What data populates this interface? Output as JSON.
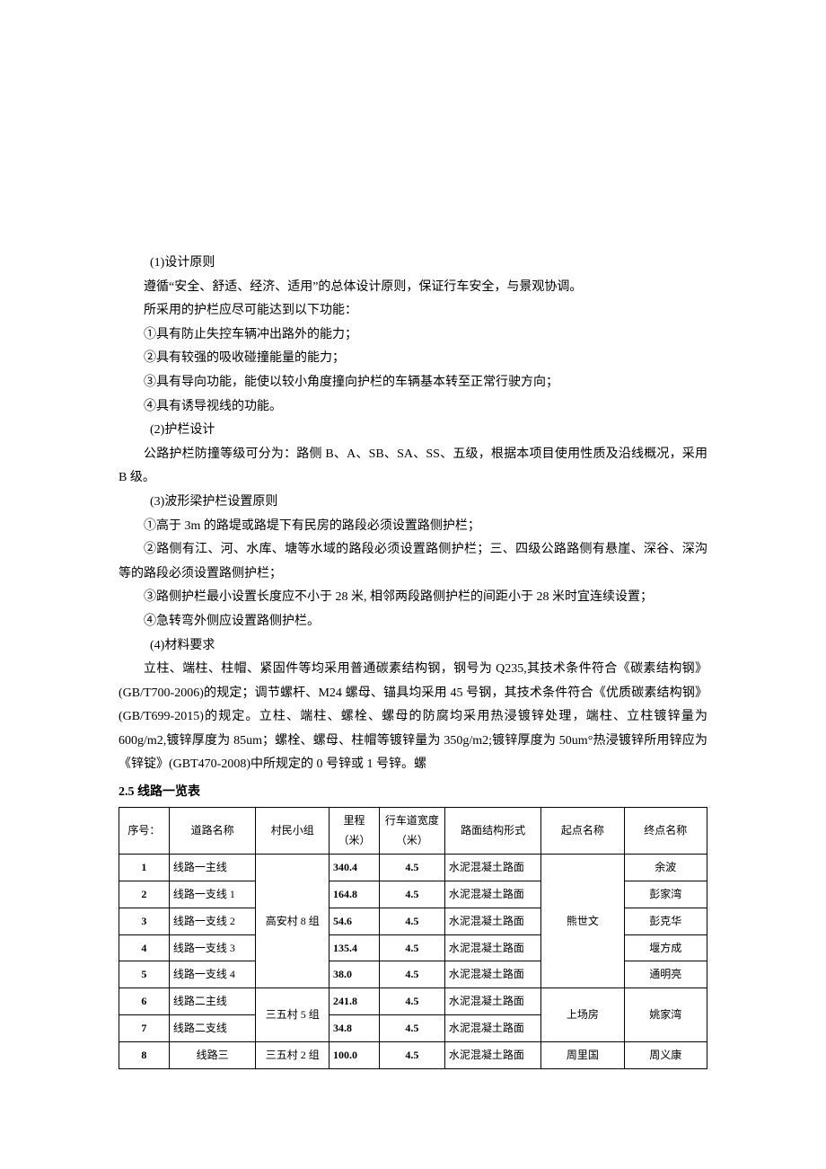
{
  "paragraphs": {
    "p1": "(1)设计原则",
    "p2": "遵循“安全、舒适、经济、适用”的总体设计原则，保证行车安全，与景观协调。",
    "p3": "所采用的护栏应尽可能达到以下功能：",
    "p4": "①具有防止失控车辆冲出路外的能力；",
    "p5": "②具有较强的吸收碰撞能量的能力；",
    "p6": "③具有导向功能，能使以较小角度撞向护栏的车辆基本转至正常行驶方向；",
    "p7": "④具有诱导视线的功能。",
    "p8": "(2)护栏设计",
    "p9": "公路护栏防撞等级可分为：路侧 B、A、SB、SA、SS、五级，根据本项目使用性质及沿线概况，采用 B 级。",
    "p10": "(3)波形梁护栏设置原则",
    "p11": "①高于 3m 的路堤或路堤下有民房的路段必须设置路侧护栏；",
    "p12": "②路侧有江、河、水库、塘等水域的路段必须设置路侧护栏；三、四级公路路侧有悬崖、深谷、深沟等的路段必须设置路侧护栏；",
    "p13": "③路侧护栏最小设置长度应不小于 28 米, 相邻两段路侧护栏的间距小于 28 米时宜连续设置；",
    "p14": "④急转弯外侧应设置路侧护栏。",
    "p15": "(4)材料要求",
    "p16": "立柱、端柱、柱帽、紧固件等均采用普通碳素结构钢，钢号为 Q235,其技术条件符合《碳素结构钢》(GB/T700-2006)的规定；调节螺杆、M24 螺母、锚具均采用 45 号钢，其技术条件符合《优质碳素结构钢》(GB/T699-2015)的规定。立柱、端柱、螺栓、螺母的防腐均采用热浸镀锌处理，端柱、立柱镀锌量为600g/m2,镀锌厚度为 85um；螺栓、螺母、柱帽等镀锌量为 350g/m2;镀锌厚度为 50um°热浸镀锌所用锌应为《锌锭》(GBT470-2008)中所规定的 0 号锌或 1 号锌。螺",
    "section_title": "2.5 线路一览表"
  },
  "table": {
    "headers": {
      "seq": "序号：",
      "road_name": "道路名称",
      "group": "村民小组",
      "mileage": "里程（米）",
      "lane_width": "行车道宽度（米）",
      "surface": "路面结构形式",
      "start": "起点名称",
      "end": "终点名称"
    },
    "group1": "高安村 8 组",
    "group2": "三五村 5 组",
    "group3": "三五村 2 组",
    "start1": "熊世文",
    "start2": "上场房",
    "start3": "周里国",
    "end2": "姚家湾",
    "rows": [
      {
        "seq": "1",
        "name": "线路一主线",
        "mile": "340.4",
        "width": "4.5",
        "surface": "水泥混凝土路面",
        "end": "余波"
      },
      {
        "seq": "2",
        "name": "线路一支线 1",
        "mile": "164.8",
        "width": "4.5",
        "surface": "水泥混凝土路面",
        "end": "彭家湾"
      },
      {
        "seq": "3",
        "name": "线路一支线 2",
        "mile": "54.6",
        "width": "4.5",
        "surface": "水泥混凝土路面",
        "end": "彭克华"
      },
      {
        "seq": "4",
        "name": "线路一支线 3",
        "mile": "135.4",
        "width": "4.5",
        "surface": "水泥混凝土路面",
        "end": "堰方成"
      },
      {
        "seq": "5",
        "name": "线路一支线 4",
        "mile": "38.0",
        "width": "4.5",
        "surface": "水泥混凝土路面",
        "end": "通明亮"
      },
      {
        "seq": "6",
        "name": "线路二主线",
        "mile": "241.8",
        "width": "4.5",
        "surface": "水泥混凝土路面"
      },
      {
        "seq": "7",
        "name": "线路二支线",
        "mile": "34.8",
        "width": "4.5",
        "surface": "水泥混凝土路面"
      },
      {
        "seq": "8",
        "name": "线路三",
        "mile": "100.0",
        "width": "4.5",
        "surface": "水泥混凝土路面",
        "end": "周义康"
      }
    ]
  }
}
